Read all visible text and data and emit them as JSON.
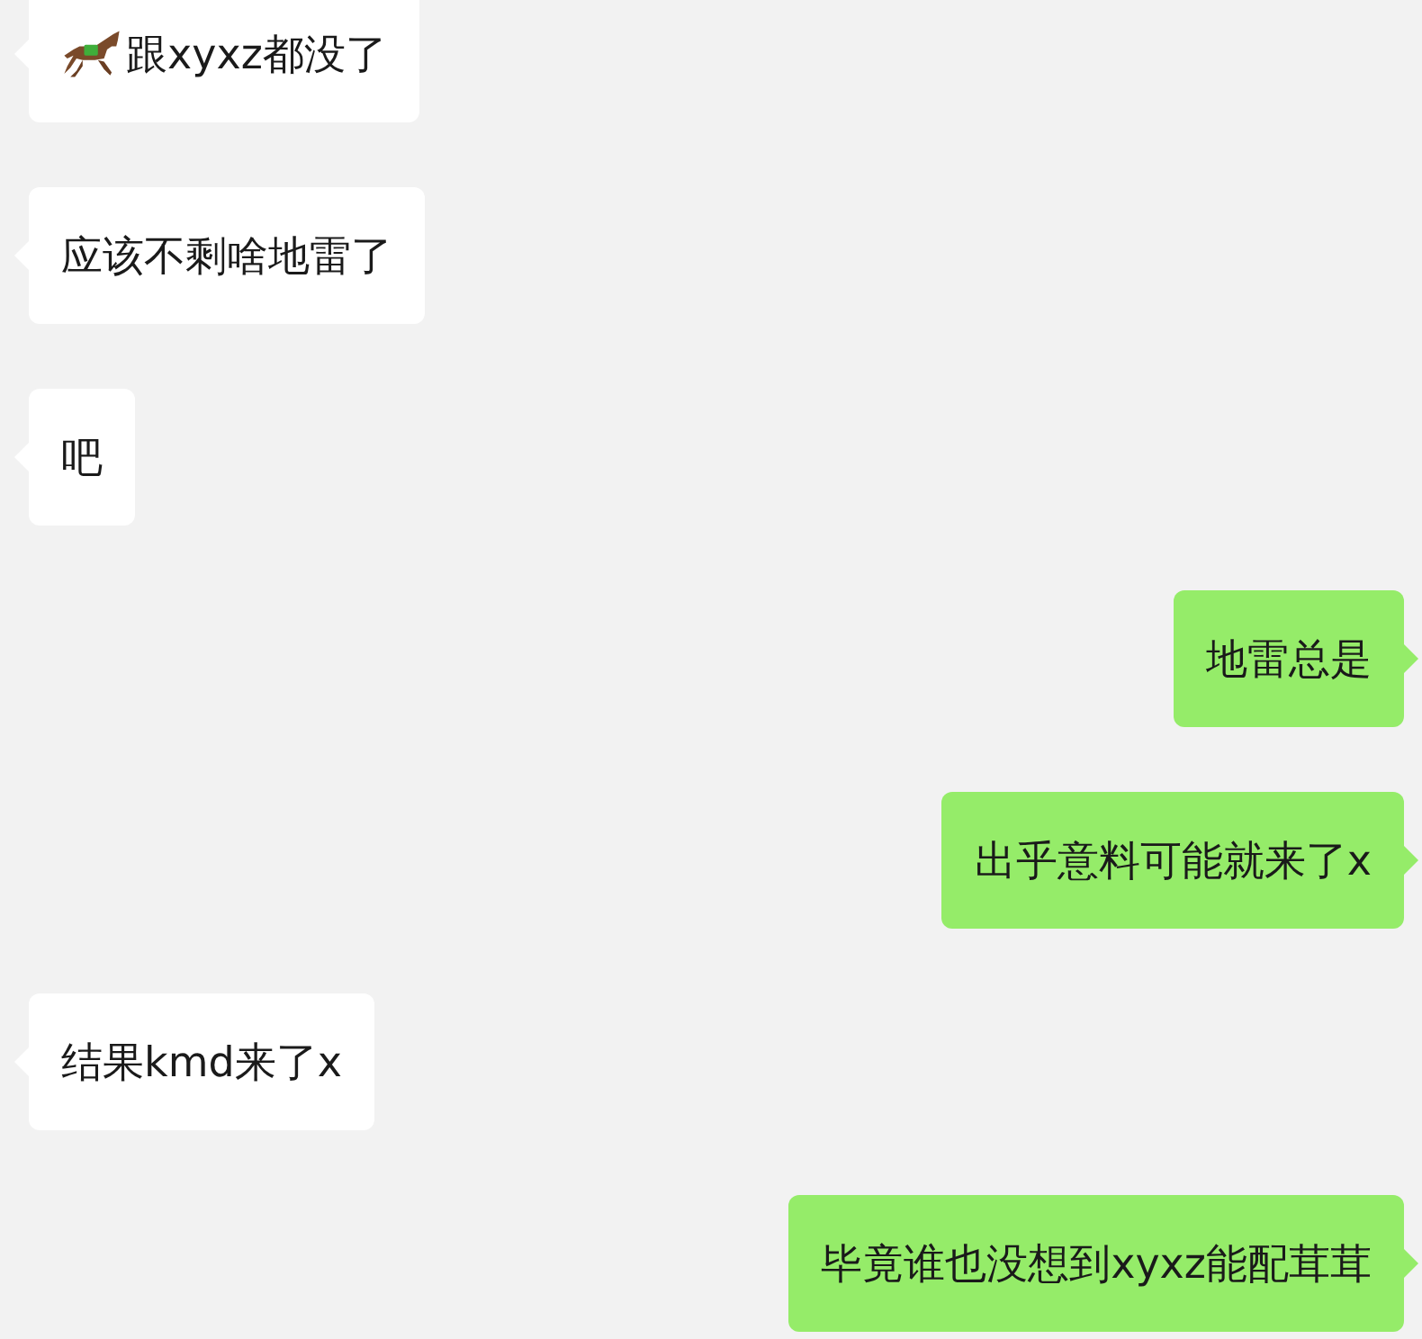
{
  "messages": [
    {
      "outgoing": false,
      "icon": true,
      "text": "跟xyxz都没了"
    },
    {
      "outgoing": false,
      "text": "应该不剩啥地雷了"
    },
    {
      "outgoing": false,
      "text": "吧"
    },
    {
      "outgoing": true,
      "text": "地雷总是"
    },
    {
      "outgoing": true,
      "text": "出乎意料可能就来了x"
    },
    {
      "outgoing": false,
      "text": "结果kmd来了x"
    },
    {
      "outgoing": true,
      "text": "毕竟谁也没想到xyxz能配茸茸"
    }
  ]
}
